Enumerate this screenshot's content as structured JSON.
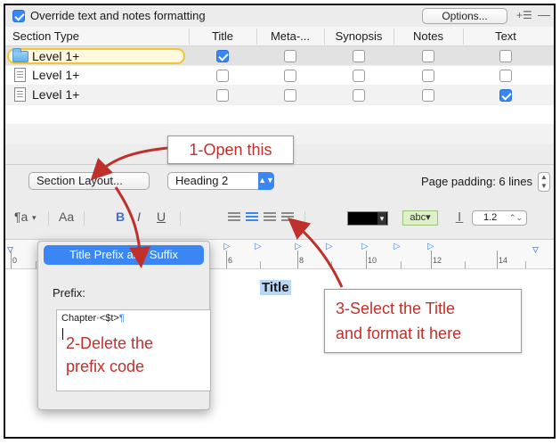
{
  "override": {
    "label": "Override text and notes formatting",
    "checked": true,
    "options_label": "Options..."
  },
  "table": {
    "headers": [
      "Section Type",
      "Title",
      "Meta-...",
      "Synopsis",
      "Notes",
      "Text"
    ],
    "rows": [
      {
        "label": "Level  1+",
        "icon": "folder-icon",
        "checks": [
          true,
          false,
          false,
          false,
          false
        ]
      },
      {
        "label": "Level  1+",
        "icon": "document-icon",
        "checks": [
          false,
          false,
          false,
          false,
          false
        ]
      },
      {
        "label": "Level  1+",
        "icon": "document-icon",
        "checks": [
          false,
          false,
          false,
          false,
          true
        ]
      }
    ]
  },
  "controls": {
    "section_layout_label": "Section Layout...",
    "style_label": "Heading 2",
    "page_padding": "Page padding: 6 lines"
  },
  "format": {
    "paragraph": "¶a",
    "font": "Aa",
    "bold": "B",
    "italic": "I",
    "underline": "U",
    "highlight": "abc",
    "line_height": "1.2"
  },
  "ruler": {
    "numbers": [
      "0",
      "6",
      "8",
      "10",
      "12",
      "14"
    ]
  },
  "editor": {
    "title_text": "Title"
  },
  "popover": {
    "tab_label": "Title Prefix and Suffix",
    "prefix_label": "Prefix:",
    "prefix_code": "Chapter·<$t>",
    "pilcrow": "¶"
  },
  "annotations": {
    "step1": "1-Open this",
    "step2_line1": "2-Delete the",
    "step2_line2": "prefix code",
    "step3_line1": "3-Select the Title",
    "step3_line2": "and format it here",
    "color": "#c0302a"
  }
}
